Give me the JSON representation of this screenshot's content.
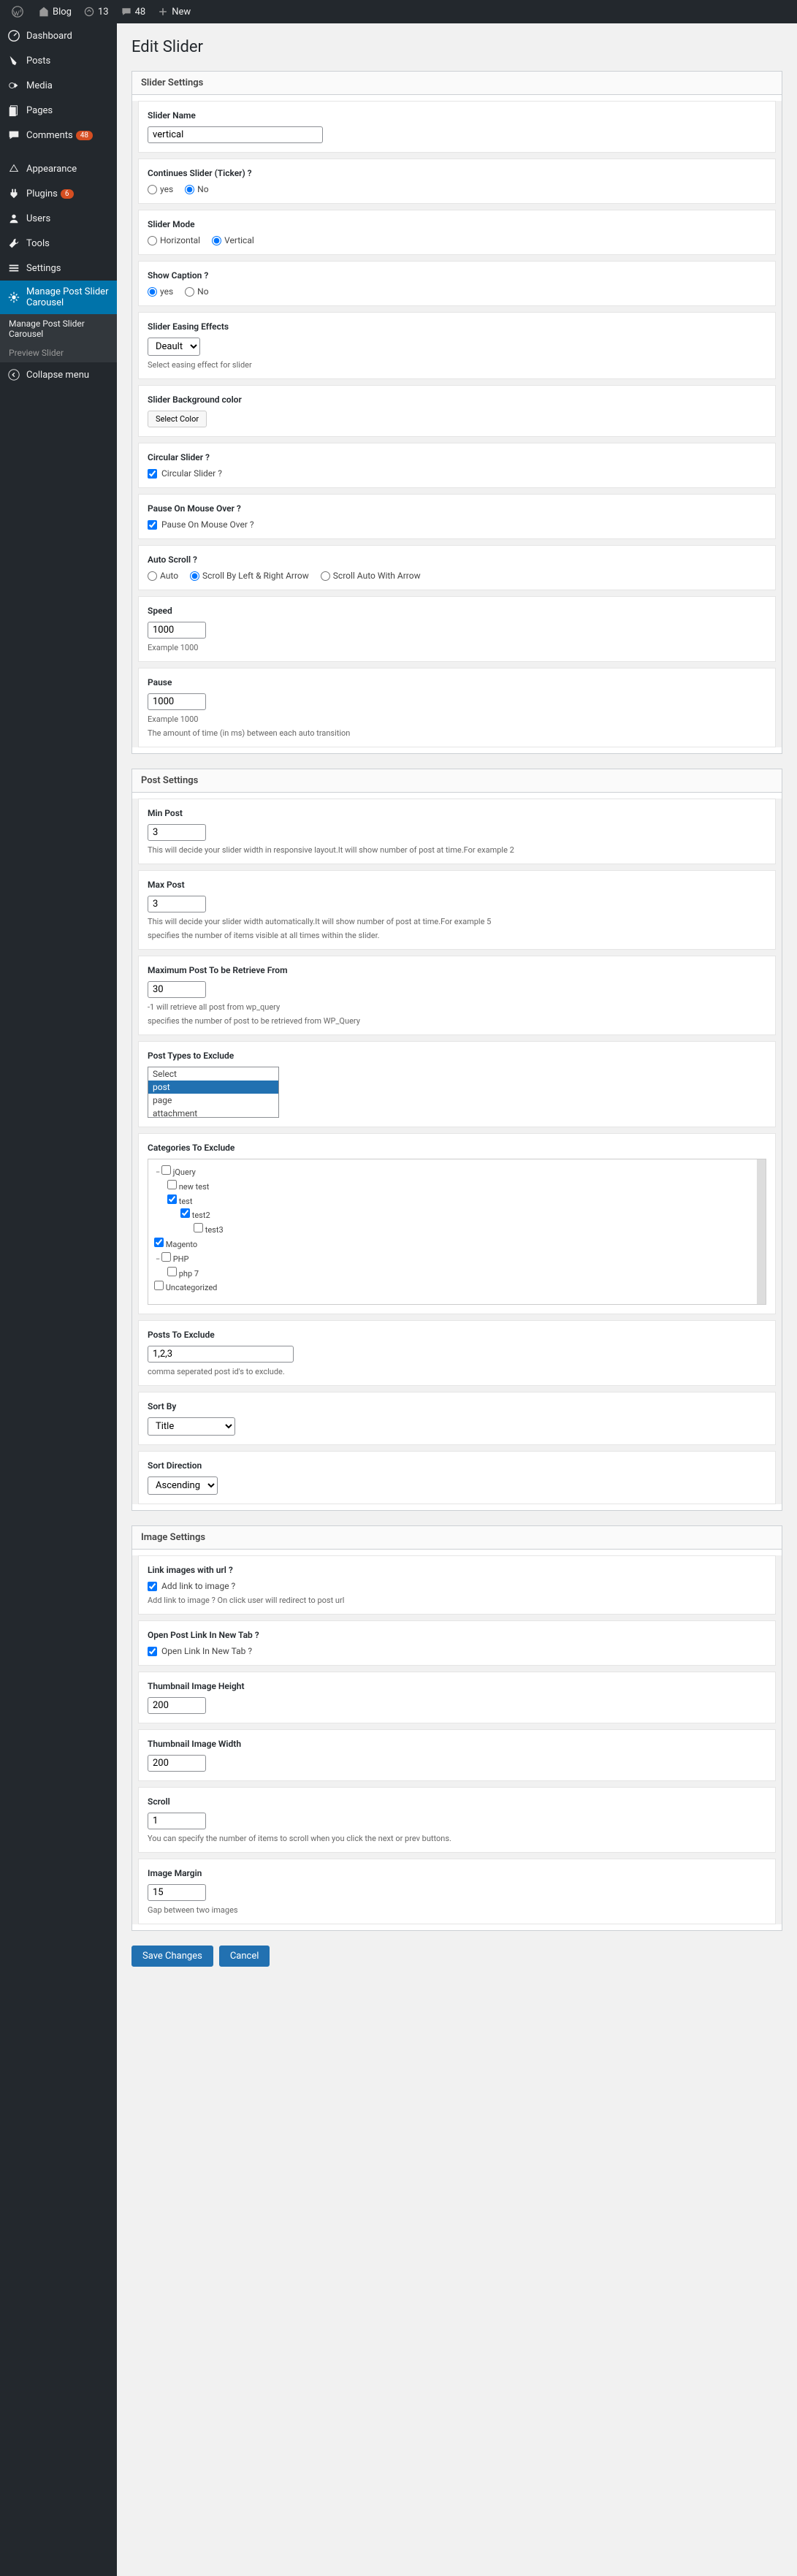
{
  "topbar": {
    "site": "Blog",
    "updates": "13",
    "comments": "48",
    "new": "New"
  },
  "sidebar": {
    "dashboard": "Dashboard",
    "posts": "Posts",
    "media": "Media",
    "pages": "Pages",
    "comments": "Comments",
    "comments_badge": "48",
    "appearance": "Appearance",
    "plugins": "Plugins",
    "plugins_badge": "6",
    "users": "Users",
    "tools": "Tools",
    "settings": "Settings",
    "manage_slider": "Manage Post Slider Carousel",
    "sub_manage": "Manage Post Slider Carousel",
    "sub_preview": "Preview Slider",
    "collapse": "Collapse menu"
  },
  "page": {
    "title": "Edit Slider"
  },
  "slider_settings": {
    "header": "Slider Settings",
    "name_label": "Slider Name",
    "name_value": "vertical",
    "continues_label": "Continues Slider (Ticker) ?",
    "yes": "yes",
    "no": "No",
    "mode_label": "Slider Mode",
    "horizontal": "Horizontal",
    "vertical": "Vertical",
    "caption_label": "Show Caption ?",
    "easing_label": "Slider Easing Effects",
    "easing_value": "Deault",
    "easing_help": "Select easing effect for slider",
    "bgcolor_label": "Slider Background color",
    "bgcolor_btn": "Select Color",
    "circular_label": "Circular Slider ?",
    "circular_cb": "Circular Slider ?",
    "pausehover_label": "Pause On Mouse Over ?",
    "pausehover_cb": "Pause On Mouse Over ?",
    "autoscroll_label": "Auto Scroll ?",
    "auto": "Auto",
    "scroll_lr": "Scroll By Left & Right Arrow",
    "scroll_auto": "Scroll Auto With Arrow",
    "speed_label": "Speed",
    "speed_value": "1000",
    "speed_help": "Example 1000",
    "pause_label": "Pause",
    "pause_value": "1000",
    "pause_help1": "Example 1000",
    "pause_help2": "The amount of time (in ms) between each auto transition"
  },
  "post_settings": {
    "header": "Post Settings",
    "minpost_label": "Min Post",
    "minpost_value": "3",
    "minpost_help": "This will decide your slider width in responsive layout.It will show number of post at time.For example 2",
    "maxpost_label": "Max Post",
    "maxpost_value": "3",
    "maxpost_help1": "This will decide your slider width automatically.It will show number of post at time.For example 5",
    "maxpost_help2": "specifies the number of items visible at all times within the slider.",
    "maxretrieve_label": "Maximum Post To be Retrieve From",
    "maxretrieve_value": "30",
    "maxretrieve_help1": "-1 will retrieve all post from wp_query",
    "maxretrieve_help2": "specifies the number of post to be retrieved from WP_Query",
    "types_label": "Post Types to Exclude",
    "types": [
      "Select",
      "post",
      "page",
      "attachment"
    ],
    "types_selected": "post",
    "cats_label": "Categories To Exclude",
    "tree": {
      "jquery": "jQuery",
      "newtest": "new test",
      "test": "test",
      "test2": "test2",
      "test3": "test3",
      "magento": "Magento",
      "php": "PHP",
      "php7": "php 7",
      "uncategorized": "Uncategorized"
    },
    "exclude_label": "Posts To Exclude",
    "exclude_value": "1,2,3",
    "exclude_help": "comma seperated post id's to exclude.",
    "sortby_label": "Sort By",
    "sortby_value": "Title",
    "sortdir_label": "Sort Direction",
    "sortdir_value": "Ascending"
  },
  "image_settings": {
    "header": "Image Settings",
    "linkimg_label": "Link images with url ?",
    "linkimg_cb": "Add link to image ?",
    "linkimg_help": "Add link to image ? On click user will redirect to post url",
    "newtab_label": "Open Post Link In New Tab ?",
    "newtab_cb": "Open Link In New Tab ?",
    "thumbh_label": "Thumbnail Image Height",
    "thumbh_value": "200",
    "thumbw_label": "Thumbnail Image Width",
    "thumbw_value": "200",
    "scroll_label": "Scroll",
    "scroll_value": "1",
    "scroll_help": "You can specify the number of items to scroll when you click the next or prev buttons.",
    "margin_label": "Image Margin",
    "margin_value": "15",
    "margin_help": "Gap between two images"
  },
  "buttons": {
    "save": "Save Changes",
    "cancel": "Cancel"
  }
}
